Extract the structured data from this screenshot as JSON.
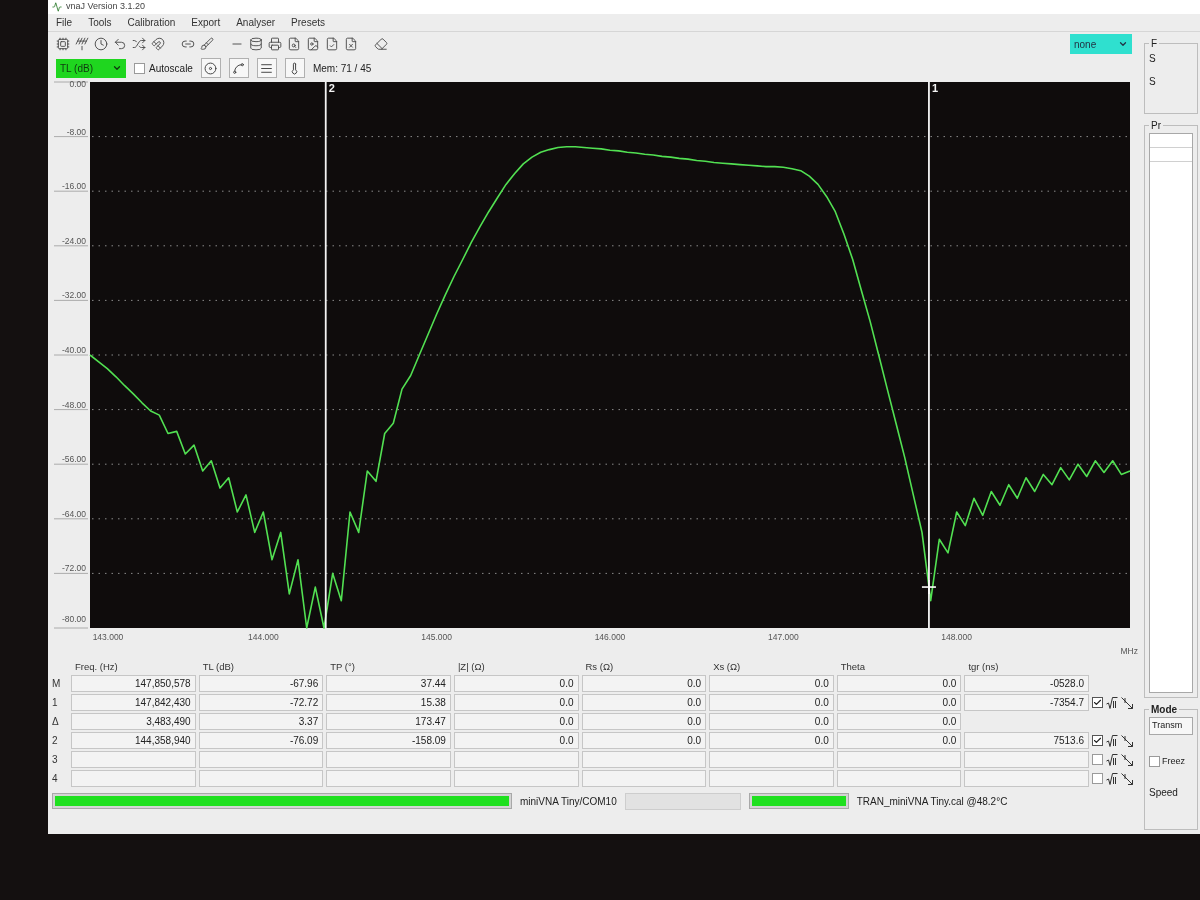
{
  "window": {
    "title": "vnaJ Version 3.1.20"
  },
  "menu": [
    "File",
    "Tools",
    "Calibration",
    "Export",
    "Analyser",
    "Presets"
  ],
  "toolbar": {
    "select": "none"
  },
  "display_bar": {
    "scale_select": "TL (dB)",
    "autoscale": {
      "label": "Autoscale",
      "checked": false
    },
    "memory": "Mem: 71 / 45"
  },
  "chart": {
    "chart_data": {
      "type": "line",
      "xlabel": "MHz",
      "grid": true,
      "x": [
        143,
        143.05,
        143.1,
        143.15,
        143.2,
        143.25,
        143.3,
        143.35,
        143.4,
        143.45,
        143.5,
        143.55,
        143.6,
        143.65,
        143.7,
        143.75,
        143.8,
        143.85,
        143.9,
        143.95,
        144,
        144.05,
        144.1,
        144.15,
        144.2,
        144.25,
        144.3,
        144.35,
        144.4,
        144.45,
        144.5,
        144.55,
        144.6,
        144.65,
        144.7,
        144.75,
        144.8,
        144.85,
        144.9,
        144.95,
        145,
        145.05,
        145.1,
        145.15,
        145.2,
        145.25,
        145.3,
        145.35,
        145.4,
        145.45,
        145.5,
        145.55,
        145.6,
        145.65,
        145.7,
        145.75,
        145.8,
        145.85,
        145.9,
        145.95,
        146,
        146.05,
        146.1,
        146.15,
        146.2,
        146.25,
        146.3,
        146.35,
        146.4,
        146.45,
        146.5,
        146.55,
        146.6,
        146.65,
        146.7,
        146.75,
        146.8,
        146.85,
        146.9,
        146.95,
        147,
        147.05,
        147.1,
        147.15,
        147.2,
        147.25,
        147.3,
        147.35,
        147.4,
        147.45,
        147.5,
        147.55,
        147.6,
        147.65,
        147.7,
        147.75,
        147.8,
        147.85,
        147.9,
        147.95,
        148,
        148.05,
        148.1,
        148.15,
        148.2,
        148.25,
        148.3,
        148.35,
        148.4,
        148.45,
        148.5,
        148.55,
        148.6,
        148.65,
        148.7,
        148.75,
        148.8,
        148.85,
        148.9,
        148.95,
        149
      ],
      "series": [
        {
          "color": "#52e052",
          "values": [
            -40,
            -41,
            -42,
            -43.2,
            -44.5,
            -45.7,
            -47,
            -48.2,
            -48.8,
            -51.5,
            -51.2,
            -54.5,
            -53.2,
            -57,
            -55.5,
            -59.5,
            -58,
            -63,
            -60.5,
            -66,
            -63,
            -70,
            -66,
            -75,
            -70,
            -80,
            -74,
            -80,
            -72,
            -76,
            -63,
            -66,
            -57,
            -58.5,
            -51.5,
            -50,
            -45,
            -43,
            -40,
            -37,
            -34,
            -31.2,
            -28.5,
            -26,
            -23.5,
            -21.2,
            -19,
            -17,
            -15,
            -13.4,
            -12,
            -11,
            -10.3,
            -9.9,
            -9.6,
            -9.5,
            -9.5,
            -9.6,
            -9.7,
            -9.8,
            -10,
            -10.1,
            -10.3,
            -10.4,
            -10.6,
            -10.7,
            -10.9,
            -11,
            -11.2,
            -11.3,
            -11.5,
            -11.6,
            -11.8,
            -11.9,
            -12,
            -12.1,
            -12.2,
            -12.3,
            -12.4,
            -12.4,
            -12.5,
            -12.7,
            -13,
            -13.8,
            -15,
            -16.8,
            -19,
            -22.3,
            -26,
            -30.5,
            -35,
            -40,
            -45,
            -50,
            -55,
            -60.5,
            -66,
            -76,
            -67,
            -69,
            -63,
            -65,
            -61,
            -63.5,
            -60,
            -62,
            -59,
            -61,
            -58,
            -60,
            -57.5,
            -59,
            -56.5,
            -58.3,
            -56,
            -57.8,
            -55.5,
            -57.2,
            -55.5,
            -57.5,
            -57
          ]
        }
      ],
      "xlim": [
        143,
        149
      ],
      "ylim": [
        -80,
        0
      ],
      "xticks": [
        {
          "value": 143,
          "label": "143.000"
        },
        {
          "value": 144,
          "label": "144.000"
        },
        {
          "value": 145,
          "label": "145.000"
        },
        {
          "value": 146,
          "label": "146.000"
        },
        {
          "value": 147,
          "label": "147.000"
        },
        {
          "value": 148,
          "label": "148.000"
        }
      ],
      "yticks": [
        {
          "value": 0,
          "label": "0.00"
        },
        {
          "value": -8,
          "label": "-8.00"
        },
        {
          "value": -16,
          "label": "-16.00"
        },
        {
          "value": -24,
          "label": "-24.00"
        },
        {
          "value": -32,
          "label": "-32.00"
        },
        {
          "value": -40,
          "label": "-40.00"
        },
        {
          "value": -48,
          "label": "-48.00"
        },
        {
          "value": -56,
          "label": "-56.00"
        },
        {
          "value": -64,
          "label": "-64.00"
        },
        {
          "value": -72,
          "label": "-72.00"
        },
        {
          "value": -80,
          "label": "-80.00"
        }
      ],
      "ref_lines": [
        {
          "axis": "x",
          "value": 144.36
        },
        {
          "axis": "x",
          "value": 147.84
        }
      ],
      "annotations": [
        {
          "text": "2",
          "x": 144.36,
          "y": -1.5
        },
        {
          "text": "1",
          "x": 147.84,
          "y": -1.5
        }
      ]
    }
  },
  "marker_table": {
    "columns": [
      "Freq. (Hz)",
      "TL (dB)",
      "TP (°)",
      "|Z| (Ω)",
      "Rs (Ω)",
      "Xs (Ω)",
      "Theta",
      "tgr (ns)"
    ],
    "rows": [
      {
        "label": "M",
        "cells": [
          "147,850,578",
          "-67.96",
          "37.44",
          "0.0",
          "0.0",
          "0.0",
          "0.0",
          "-0528.0"
        ]
      },
      {
        "label": "1",
        "cells": [
          "147,842,430",
          "-72.72",
          "15.38",
          "0.0",
          "0.0",
          "0.0",
          "0.0",
          "-7354.7"
        ],
        "toggle": {
          "checked": true
        }
      },
      {
        "label": "Δ",
        "cells": [
          "3,483,490",
          "3.37",
          "173.47",
          "0.0",
          "0.0",
          "0.0",
          "0.0"
        ]
      },
      {
        "label": "2",
        "cells": [
          "144,358,940",
          "-76.09",
          "-158.09",
          "0.0",
          "0.0",
          "0.0",
          "0.0",
          "7513.6"
        ],
        "toggle": {
          "checked": true
        }
      },
      {
        "label": "3",
        "cells": [
          null,
          null,
          null,
          null,
          null,
          null,
          null,
          null
        ],
        "toggle": {
          "checked": false
        }
      },
      {
        "label": "4",
        "cells": [
          null,
          null,
          null,
          null,
          null,
          null,
          null,
          null
        ],
        "toggle": {
          "checked": false
        }
      }
    ]
  },
  "status_bar": {
    "progress": {
      "level": 1
    },
    "device": "miniVNA Tiny/COM10",
    "sweep": {
      "level": 1
    },
    "calibration": "TRAN_miniVNA Tiny.cal @48.2°C"
  },
  "side_panel": {
    "groups": [
      {
        "kind": "options",
        "title": "F",
        "items": [
          "S",
          "S"
        ]
      },
      {
        "kind": "list",
        "title": "Pr"
      },
      {
        "kind": "mode",
        "title": "Mode",
        "select": "Transm",
        "freeze": {
          "label": "Freez",
          "checked": false
        },
        "speed": "Speed"
      }
    ]
  }
}
